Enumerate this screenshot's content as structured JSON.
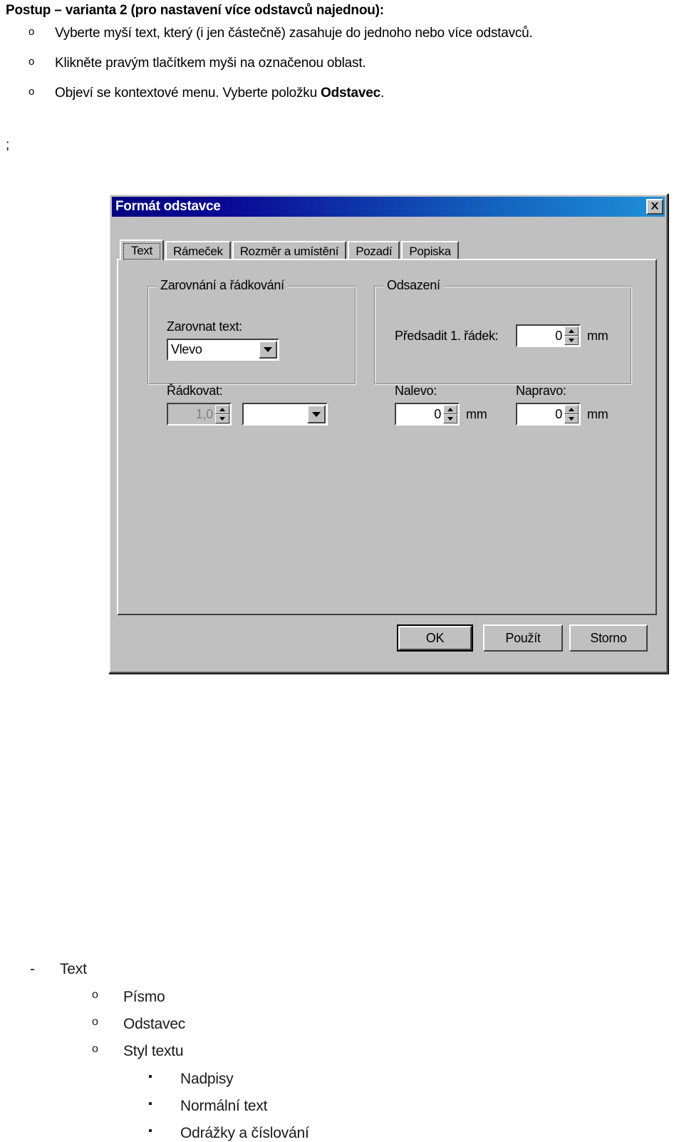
{
  "document": {
    "heading": "Postup – varianta 2 (pro nastavení více odstavců najednou):",
    "bullets": [
      {
        "marker": "o",
        "text_before": "Vyberte myší text, který (i jen částečně) zasahuje do jednoho nebo více odstavců.",
        "bold": "",
        "text_after": ""
      },
      {
        "marker": "o",
        "text_before": "Klikněte pravým tlačítkem myši na označenou oblast.",
        "bold": "",
        "text_after": ""
      },
      {
        "marker": "o",
        "text_before": "Objeví se kontextové menu. Vyberte položku ",
        "bold": "Odstavec",
        "text_after": "."
      }
    ],
    "stray_text": ";"
  },
  "dialog": {
    "title": "Formát odstavce",
    "close_icon": "close-icon",
    "tabs": [
      {
        "label": "Text",
        "active": true
      },
      {
        "label": "Rámeček",
        "active": false
      },
      {
        "label": "Rozměr a umístění",
        "active": false
      },
      {
        "label": "Pozadí",
        "active": false
      },
      {
        "label": "Popiska",
        "active": false
      }
    ],
    "group_alignment": {
      "legend": "Zarovnání a řádkování",
      "align_label": "Zarovnat text:",
      "align_value": "Vlevo",
      "spacing_label": "Řádkovat:",
      "spacing_value": "1,0",
      "spacing_disabled": true,
      "spacing_combo_value": ""
    },
    "group_indent": {
      "legend": "Odsazení",
      "first_line_label": "Předsadit 1. řádek:",
      "first_line_value": "0",
      "first_line_unit": "mm",
      "left_label": "Nalevo:",
      "left_value": "0",
      "left_unit": "mm",
      "right_label": "Napravo:",
      "right_value": "0",
      "right_unit": "mm"
    },
    "buttons": {
      "ok": "OK",
      "apply": "Použít",
      "cancel": "Storno"
    }
  },
  "outline": {
    "l1_marker": "-",
    "l1_label": "Text",
    "level2": [
      {
        "marker": "o",
        "label": "Písmo"
      },
      {
        "marker": "o",
        "label": "Odstavec"
      },
      {
        "marker": "o",
        "label": "Styl textu"
      }
    ],
    "level3": [
      {
        "marker": "▪",
        "label": "Nadpisy"
      },
      {
        "marker": "▪",
        "label": "Normální text"
      },
      {
        "marker": "▪",
        "label": "Odrážky a číslování"
      }
    ]
  },
  "colors": {
    "dialog_face": "#c0c0c0",
    "titlebar_start": "#000082",
    "titlebar_end": "#2090d8",
    "titlebar_text": "#ffffff"
  }
}
